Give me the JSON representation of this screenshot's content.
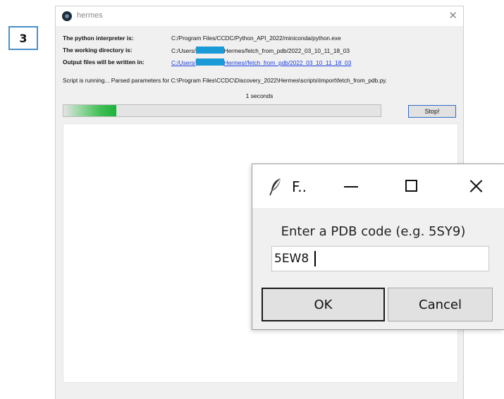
{
  "step": {
    "number": "3"
  },
  "main_window": {
    "title": "hermes",
    "close_symbol": "✕",
    "info": [
      {
        "label": "The python interpreter is:",
        "value": "C:/Program Files/CCDC/Python_API_2022/miniconda/python.exe"
      },
      {
        "label": "The working directory is:",
        "prefix": "C:/Users/",
        "suffix": "Hermes/fetch_from_pdb/2022_03_10_11_18_03"
      },
      {
        "label": "Output files will be written in:",
        "prefix": "C:/Users/",
        "suffix": "Hermes//fetch_from_pdb/2022_03_10_11_18_03"
      }
    ],
    "status": "Script is running... Parsed parameters for C:\\Program Files\\CCDC\\Discovery_2022\\Hermes\\scripts\\Import\\fetch_from_pdb.py.",
    "timer": "1 seconds",
    "stop_label": "Stop!",
    "progress_indicator": {
      "kind": "indeterminate-marquee",
      "color": "#21b03c"
    },
    "icons": {
      "app": "hermes-app-icon",
      "close": "close-icon"
    }
  },
  "dialog": {
    "title": "F..",
    "prompt": "Enter a PDB code (e.g. 5SY9)",
    "input_value": "5EW8",
    "ok_label": "OK",
    "cancel_label": "Cancel",
    "icons": {
      "app": "feather-icon",
      "minimize": "minimize-icon",
      "maximize": "maximize-icon",
      "close": "close-icon"
    }
  },
  "colors": {
    "link": "#1a3fe0",
    "redaction": "#1a9ad6",
    "focus_border": "#2f6bcb",
    "progress_green": "#21b03c",
    "badge_border": "#4a90c8"
  }
}
